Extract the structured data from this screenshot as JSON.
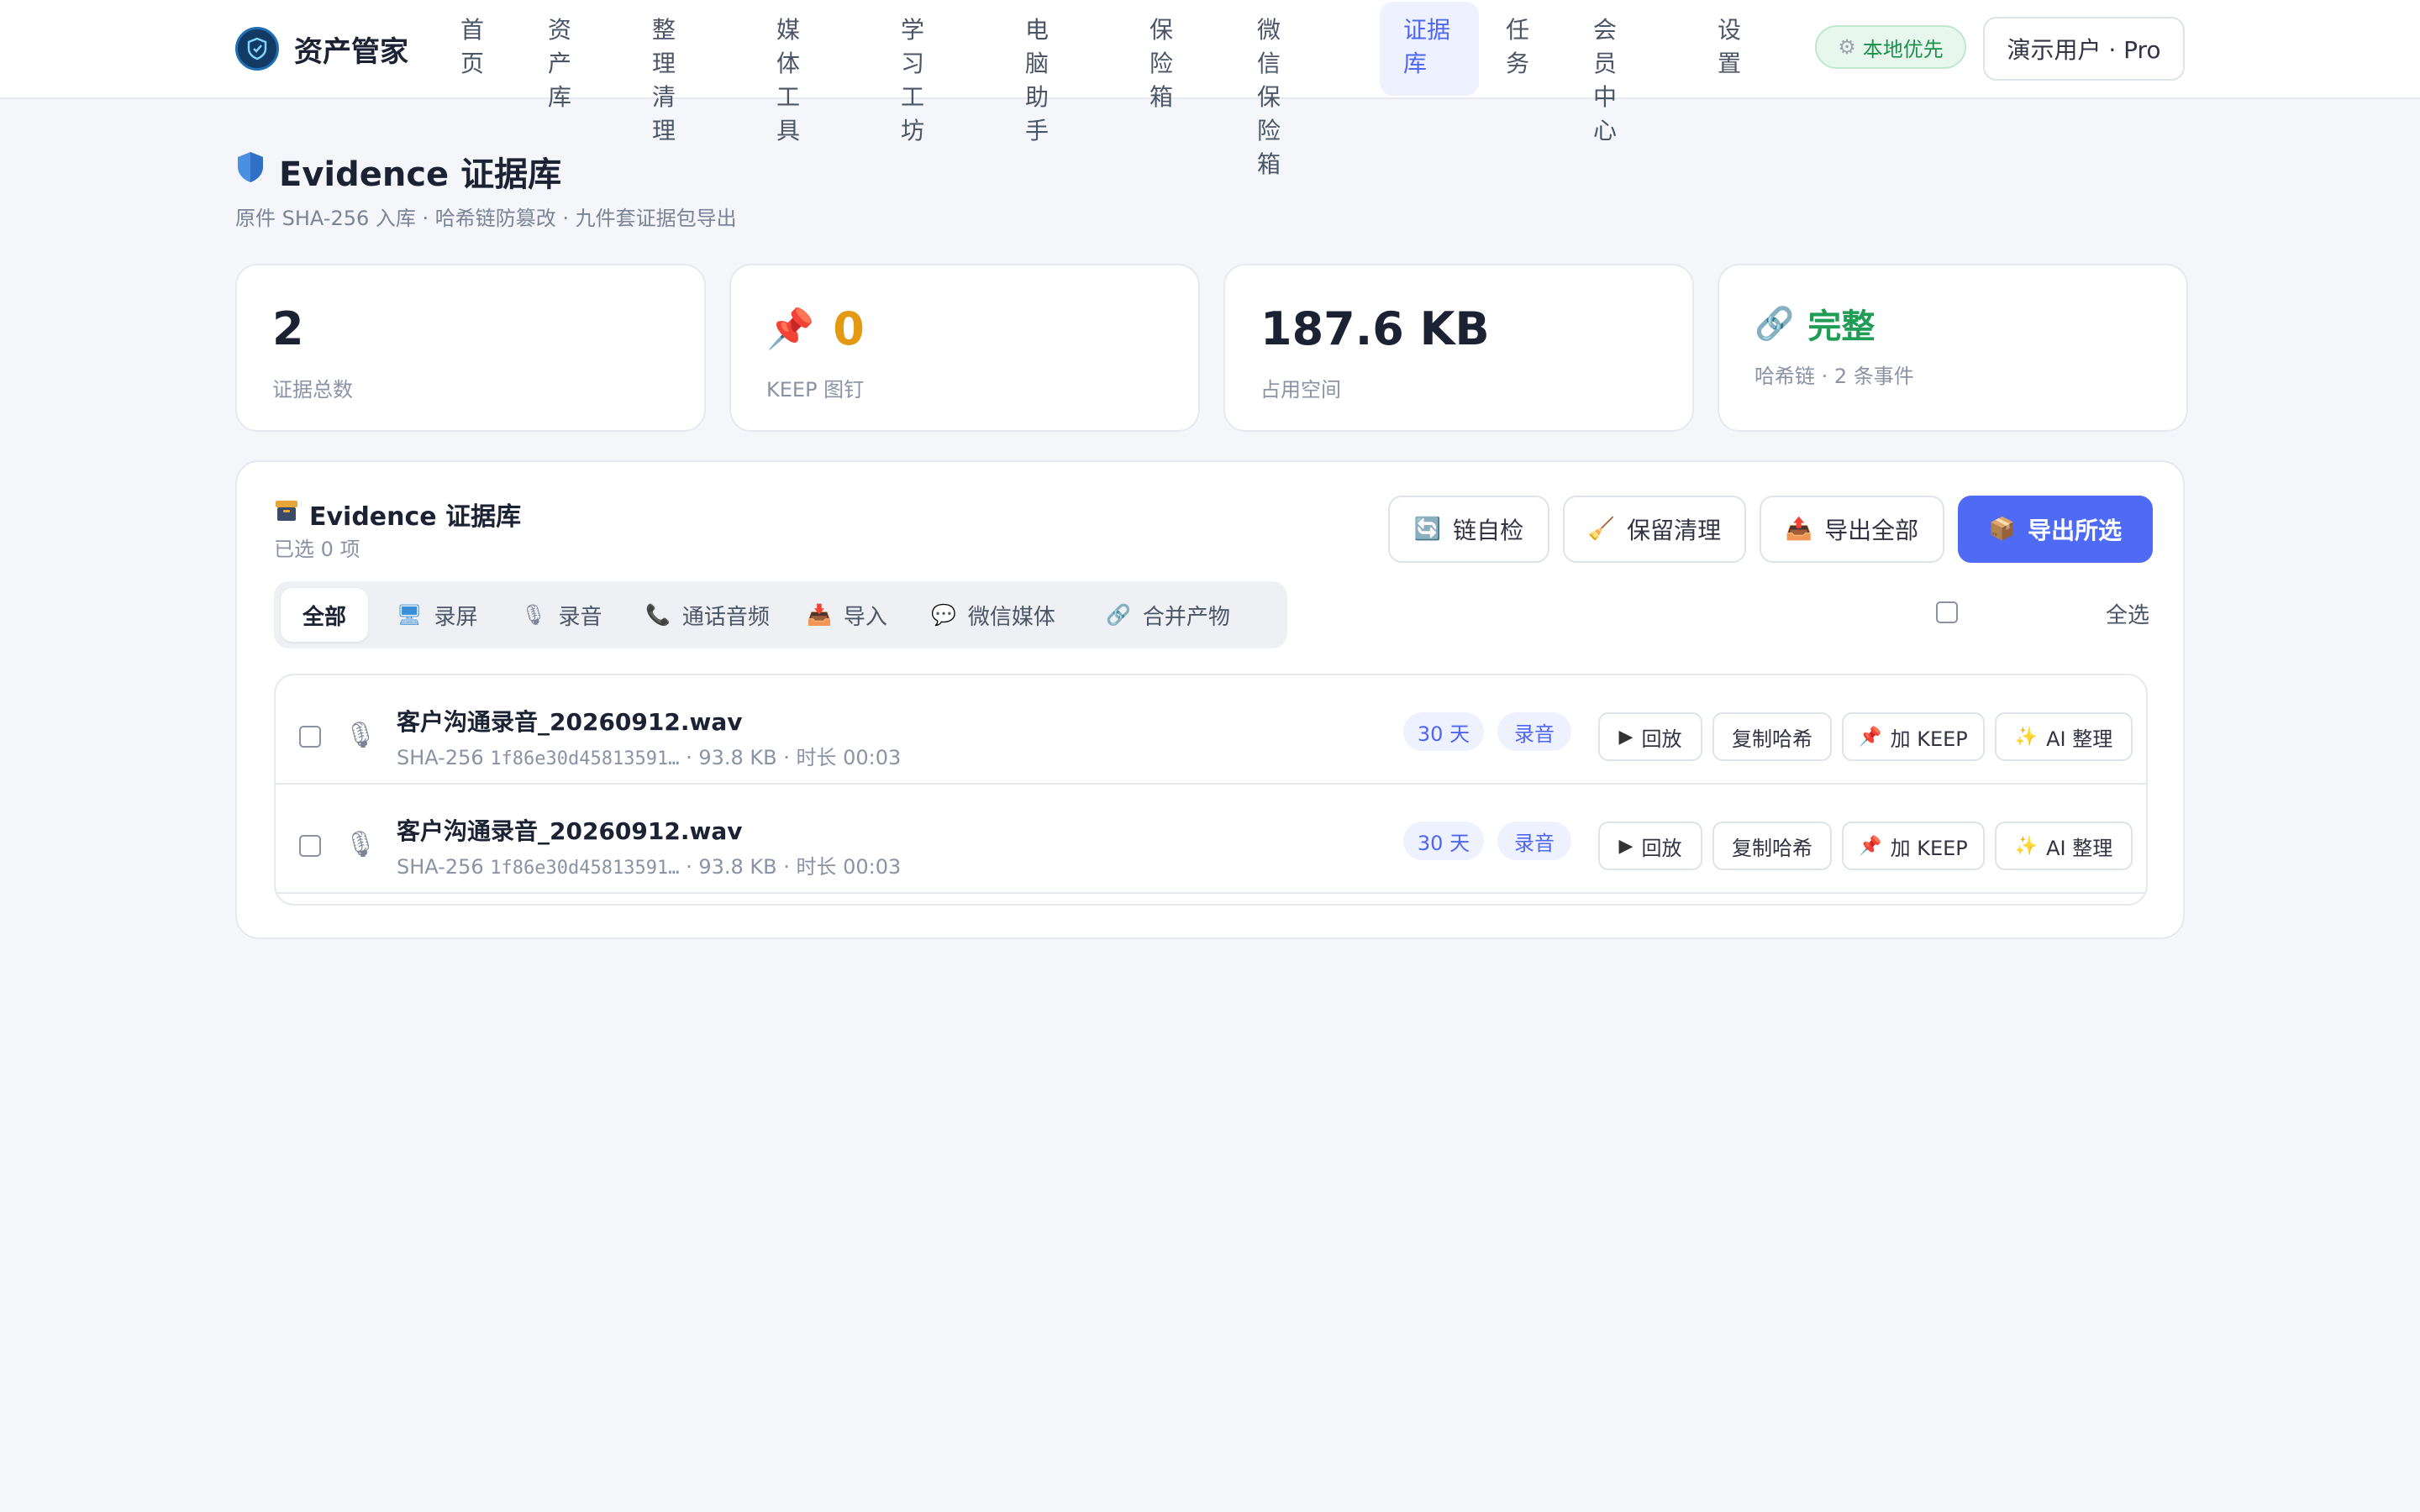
{
  "header": {
    "brand": "资产管家",
    "nav": [
      {
        "label": "首页",
        "l1": "首",
        "l2": "页"
      },
      {
        "label": "资产库",
        "l1": "资产",
        "l2": "库"
      },
      {
        "label": "整理清理",
        "l1": "整理清",
        "l2": "理"
      },
      {
        "label": "媒体工具",
        "l1": "媒体工",
        "l2": "具"
      },
      {
        "label": "学习工坊",
        "l1": "学习工",
        "l2": "坊"
      },
      {
        "label": "电脑助手",
        "l1": "电脑助",
        "l2": "手"
      },
      {
        "label": "保险箱",
        "l1": "保险",
        "l2": "箱"
      },
      {
        "label": "微信保险箱",
        "l1": "微信保",
        "l2": "险箱"
      },
      {
        "label": "证据库",
        "l1": "证据",
        "l2": "库"
      },
      {
        "label": "任务",
        "l1": "任",
        "l2": "务"
      },
      {
        "label": "会员中心",
        "l1": "会员中",
        "l2": "心"
      },
      {
        "label": "设置",
        "l1": "设",
        "l2": "置"
      }
    ],
    "active_nav": "证据库",
    "local_badge": "本地优先",
    "user": "演示用户 · Pro"
  },
  "page": {
    "title": "Evidence 证据库",
    "subtitle": "原件 SHA-256 入库 · 哈希链防篡改 · 九件套证据包导出"
  },
  "stats": [
    {
      "value": "2",
      "label": "证据总数"
    },
    {
      "value": "0",
      "label": "KEEP 图钉"
    },
    {
      "value": "187.6 KB",
      "label": "占用空间"
    },
    {
      "value": "完整",
      "label": "哈希链 · 2 条事件"
    }
  ],
  "panel": {
    "title": "Evidence 证据库",
    "selected": "已选 0 项",
    "actions": {
      "chain_check": "链自检",
      "retention_clean": "保留清理",
      "export_all": "导出全部",
      "export_selected": "导出所选"
    },
    "tabs": [
      "全部",
      "录屏",
      "录音",
      "通话音频",
      "导入",
      "微信媒体",
      "合并产物"
    ],
    "select_all": "全选"
  },
  "rows": [
    {
      "name": "客户沟通录音_20260912.wav",
      "hash_prefix": "SHA-256",
      "hash": "1f86e30d45813591…",
      "meta": " · 93.8 KB · 时长 00:03",
      "retention": "30 天",
      "type": "录音",
      "play": "回放",
      "copy_hash": "复制哈希",
      "keep": "加 KEEP",
      "ai": "AI 整理"
    },
    {
      "name": "客户沟通录音_20260912.wav",
      "hash_prefix": "SHA-256",
      "hash": "1f86e30d45813591…",
      "meta": " · 93.8 KB · 时长 00:03",
      "retention": "30 天",
      "type": "录音",
      "play": "回放",
      "copy_hash": "复制哈希",
      "keep": "加 KEEP",
      "ai": "AI 整理"
    }
  ],
  "colors": {
    "accent": "#4f6bf5",
    "keep_value": "#e39a12",
    "chain_ok": "#1f9c55"
  }
}
